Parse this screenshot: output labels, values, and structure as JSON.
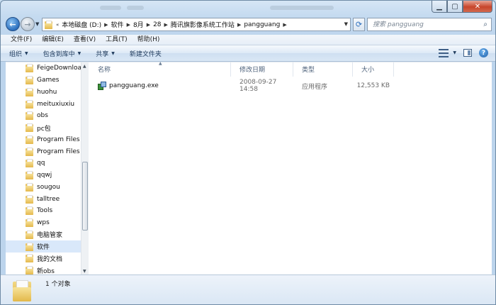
{
  "addressbar": {
    "overflow": "«",
    "crumbs": [
      "本地磁盘 (D:)",
      "软件",
      "8月",
      "28",
      "腾讯旗影像系统工作站",
      "pangguang"
    ]
  },
  "search": {
    "placeholder": "搜索 pangguang"
  },
  "menubar": [
    "文件(F)",
    "编辑(E)",
    "查看(V)",
    "工具(T)",
    "帮助(H)"
  ],
  "toolbar": {
    "organize": "组织",
    "include_library": "包含到库中",
    "share": "共享",
    "new_folder": "新建文件夹"
  },
  "tree": {
    "items": [
      "FeigeDownloa",
      "Games",
      "huohu",
      "meituxiuxiu",
      "obs",
      "pc包",
      "Program Files",
      "Program Files",
      "qq",
      "qqwj",
      "sougou",
      "talltree",
      "Tools",
      "wps",
      "电脑管家",
      "软件",
      "我的文档",
      "新obs"
    ],
    "selected": "软件"
  },
  "columns": {
    "name": "名称",
    "modified": "修改日期",
    "type": "类型",
    "size": "大小"
  },
  "files": [
    {
      "name": "pangguang.exe",
      "modified": "2008-09-27 14:58",
      "type": "应用程序",
      "size": "12,553 KB"
    }
  ],
  "status": {
    "count": "1 个对象"
  },
  "colors": {
    "selection": "#d9e8fa",
    "frame": "#bcd4ec"
  }
}
